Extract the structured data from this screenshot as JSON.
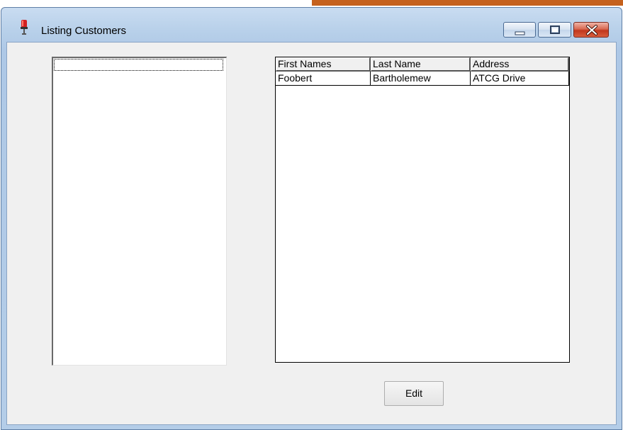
{
  "window": {
    "title": "Listing Customers",
    "controls": {
      "minimize": "minimize",
      "maximize": "maximize",
      "close": "close"
    }
  },
  "list_box": {
    "items": []
  },
  "grid": {
    "columns": [
      "First Names",
      "Last Name",
      "Address"
    ],
    "rows": [
      [
        "Foobert",
        "Bartholemew",
        "ATCG Drive"
      ]
    ]
  },
  "buttons": {
    "edit": "Edit"
  },
  "colors": {
    "close_button": "#c1371d",
    "title_bar": "#b9d1ea",
    "client_bg": "#f0f0f0"
  }
}
